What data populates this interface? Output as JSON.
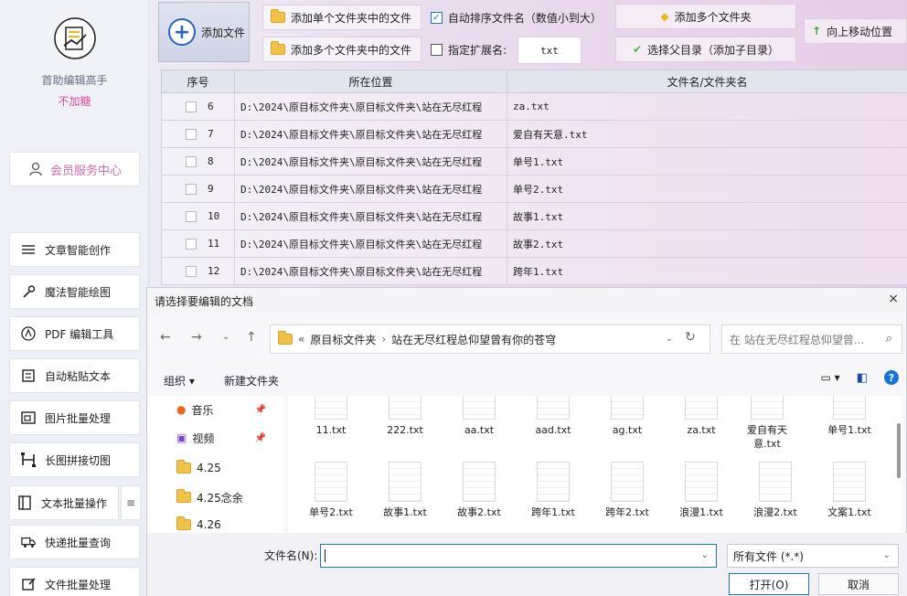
{
  "sidebar": {
    "app_name": "首助编辑高手",
    "app_sub": "不加糖",
    "member_label": "会员服务中心",
    "items": [
      {
        "label": "文章智能创作",
        "icon": "list-icon"
      },
      {
        "label": "魔法智能绘图",
        "icon": "magic-icon"
      },
      {
        "label": "PDF 编辑工具",
        "icon": "pdf-icon"
      },
      {
        "label": "自动粘贴文本",
        "icon": "paste-icon"
      },
      {
        "label": "图片批量处理",
        "icon": "image-icon"
      },
      {
        "label": "长图拼接切图",
        "icon": "crop-icon"
      },
      {
        "label": "文本批量操作",
        "icon": "text-icon"
      },
      {
        "label": "快递批量查询",
        "icon": "truck-icon"
      },
      {
        "label": "文件批量处理",
        "icon": "file-edit-icon"
      }
    ]
  },
  "toolbar": {
    "add_file": "添加文件",
    "add_single_folder_files": "添加单个文件夹中的文件",
    "add_multi_folder_files": "添加多个文件夹中的文件",
    "auto_sort": "自动排序文件名（数值小到大）",
    "specify_ext": "指定扩展名:",
    "ext_value": "txt",
    "add_multi_folders": "添加多个文件夹",
    "choose_parent": "选择父目录（添加子目录）",
    "move_up": "向上移动位置"
  },
  "table": {
    "headers": [
      "序号",
      "所在位置",
      "文件名/文件夹名"
    ],
    "rows": [
      {
        "seq": "6",
        "path": "D:\\2024\\原目标文件夹\\原目标文件夹\\站在无尽红程",
        "name": "za.txt"
      },
      {
        "seq": "7",
        "path": "D:\\2024\\原目标文件夹\\原目标文件夹\\站在无尽红程",
        "name": "爱自有天意.txt"
      },
      {
        "seq": "8",
        "path": "D:\\2024\\原目标文件夹\\原目标文件夹\\站在无尽红程",
        "name": "单号1.txt"
      },
      {
        "seq": "9",
        "path": "D:\\2024\\原目标文件夹\\原目标文件夹\\站在无尽红程",
        "name": "单号2.txt"
      },
      {
        "seq": "10",
        "path": "D:\\2024\\原目标文件夹\\原目标文件夹\\站在无尽红程",
        "name": "故事1.txt"
      },
      {
        "seq": "11",
        "path": "D:\\2024\\原目标文件夹\\原目标文件夹\\站在无尽红程",
        "name": "故事2.txt"
      },
      {
        "seq": "12",
        "path": "D:\\2024\\原目标文件夹\\原目标文件夹\\站在无尽红程",
        "name": "跨年1.txt"
      }
    ]
  },
  "dialog": {
    "title": "请选择要编辑的文档",
    "close": "×",
    "breadcrumb_prefix": "«",
    "breadcrumb": [
      "原目标文件夹",
      "站在无尽红程总仰望曾有你的苍穹"
    ],
    "search_placeholder": "在 站在无尽红程总仰望曾...",
    "organize": "组织 ▾",
    "new_folder": "新建文件夹",
    "tree": [
      {
        "label": "音乐",
        "icon": "music-icon",
        "pinned": true
      },
      {
        "label": "视频",
        "icon": "video-icon",
        "pinned": true
      },
      {
        "label": "4.25",
        "icon": "folder-icon",
        "pinned": false
      },
      {
        "label": "4.25念余",
        "icon": "folder-icon",
        "pinned": false
      },
      {
        "label": "4.26",
        "icon": "folder-icon",
        "pinned": false
      }
    ],
    "files_row1": [
      "11.txt",
      "222.txt",
      "aa.txt",
      "aad.txt",
      "ag.txt",
      "za.txt",
      "爱自有天意.txt",
      "单号1.txt"
    ],
    "files_row2": [
      "单号2.txt",
      "故事1.txt",
      "故事2.txt",
      "跨年1.txt",
      "跨年2.txt",
      "浪漫1.txt",
      "浪漫2.txt",
      "文案1.txt"
    ],
    "filename_label": "文件名(N):",
    "filename_value": "",
    "filetype": "所有文件 (*.*)",
    "open_btn": "打开(O)",
    "cancel_btn": "取消"
  },
  "colors": {
    "accent": "#1a73d9",
    "brand_pink": "#d64d9a",
    "folder": "#f1c24a"
  }
}
